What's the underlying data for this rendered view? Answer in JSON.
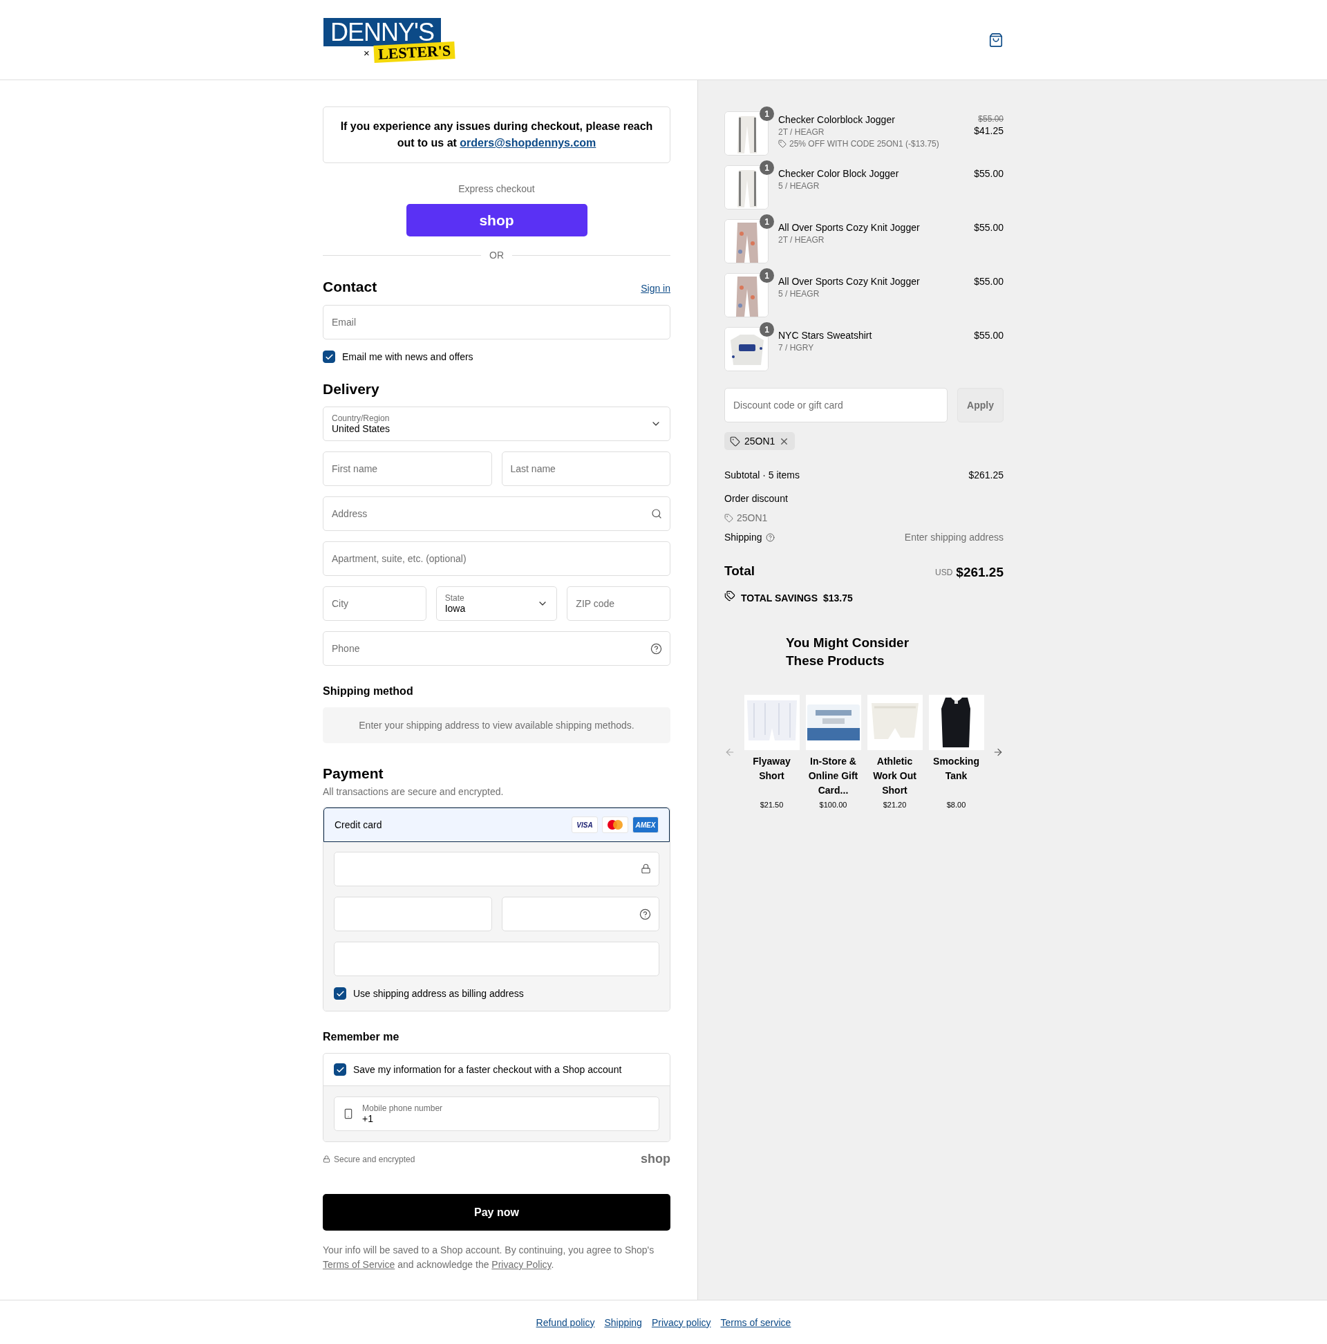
{
  "logo": {
    "primary": "DENNY'S",
    "connector": "×",
    "secondary": "LESTER'S"
  },
  "notice": {
    "text": "If you experience any issues during checkout, please reach out to us at",
    "link": "orders@shopdennys.com"
  },
  "express": {
    "label": "Express checkout",
    "button": "shop",
    "divider": "OR"
  },
  "contact": {
    "title": "Contact",
    "sign_in": "Sign in",
    "email": {
      "placeholder": "Email"
    },
    "newsletter": {
      "label": "Email me with news and offers",
      "checked": true
    }
  },
  "delivery": {
    "title": "Delivery",
    "country": {
      "label": "Country/Region",
      "value": "United States"
    },
    "fields": [
      {
        "placeholder": "First name"
      },
      {
        "placeholder": "Last name"
      }
    ],
    "address": {
      "placeholder": "Address"
    },
    "apartment": {
      "placeholder": "Apartment, suite, etc. (optional)"
    },
    "city": {
      "placeholder": "City"
    },
    "state": {
      "label": "State",
      "value": "Iowa"
    },
    "zip": {
      "placeholder": "ZIP code"
    },
    "phone": {
      "placeholder": "Phone"
    }
  },
  "shipping_method": {
    "title": "Shipping method",
    "message": "Enter your shipping address to view available shipping methods."
  },
  "payment": {
    "title": "Payment",
    "subtitle": "All transactions are secure and encrypted.",
    "methods": [
      {
        "label": "Credit card",
        "selected": true
      }
    ],
    "brands": [
      {
        "kind": "visa",
        "label": "VISA"
      },
      {
        "kind": "mastercard"
      },
      {
        "kind": "amex",
        "label": "AMEX"
      }
    ],
    "billing": {
      "label": "Use shipping address as billing address",
      "checked": true
    }
  },
  "remember": {
    "title": "Remember me",
    "save": {
      "label": "Save my information for a faster checkout with a Shop account",
      "checked": true
    },
    "mobile": {
      "label": "Mobile phone number",
      "value": "+1"
    },
    "secure": "Secure and encrypted",
    "brand": "shop"
  },
  "pay_button": "Pay now",
  "terms": [
    {
      "kind": "text",
      "text": "Your info will be saved to a Shop account. By continuing, you agree to Shop's "
    },
    {
      "kind": "link",
      "text": "Terms of Service"
    },
    {
      "kind": "text",
      "text": " and acknowledge the "
    },
    {
      "kind": "link",
      "text": "Privacy Policy"
    },
    {
      "kind": "text",
      "text": "."
    }
  ],
  "cart": {
    "items": [
      {
        "quantity": "1",
        "name": "Checker Colorblock Jogger",
        "variant": "2T / HEAGR",
        "original_price": "$55.00",
        "price": "$41.25",
        "discount": "25% OFF WITH CODE 25ON1 (-$13.75)"
      },
      {
        "quantity": "1",
        "name": "Checker Color Block Jogger",
        "variant": "5 / HEAGR",
        "price": "$55.00"
      },
      {
        "quantity": "1",
        "name": "All Over Sports Cozy Knit Jogger",
        "variant": "2T / HEAGR",
        "price": "$55.00"
      },
      {
        "quantity": "1",
        "name": "All Over Sports Cozy Knit Jogger",
        "variant": "5 / HEAGR",
        "price": "$55.00"
      },
      {
        "quantity": "1",
        "name": "NYC Stars Sweatshirt",
        "variant": "7 / HGRY",
        "price": "$55.00"
      }
    ]
  },
  "discount": {
    "placeholder": "Discount code or gift card",
    "button": "Apply",
    "applied": "25ON1"
  },
  "summary": {
    "subtotal_label": "Subtotal · 5 items",
    "subtotal": "$261.25",
    "order_discount_label": "Order discount",
    "order_discount_code": "25ON1",
    "shipping_label": "Shipping",
    "shipping_value": "Enter shipping address",
    "total_label": "Total",
    "currency": "USD",
    "total": "$261.25",
    "savings_label": "TOTAL SAVINGS",
    "savings": "$13.75"
  },
  "recommendations": {
    "title": "You Might Consider These Products",
    "products": [
      {
        "name": "Flyaway Short",
        "price": "$21.50"
      },
      {
        "name": "In-Store & Online Gift Card...",
        "price": "$100.00"
      },
      {
        "name": "Athletic Work Out Short",
        "price": "$21.20"
      },
      {
        "name": "Smocking Tank",
        "price": "$8.00"
      }
    ]
  },
  "footer_links": [
    "Refund policy",
    "Shipping",
    "Privacy policy",
    "Terms of service"
  ]
}
